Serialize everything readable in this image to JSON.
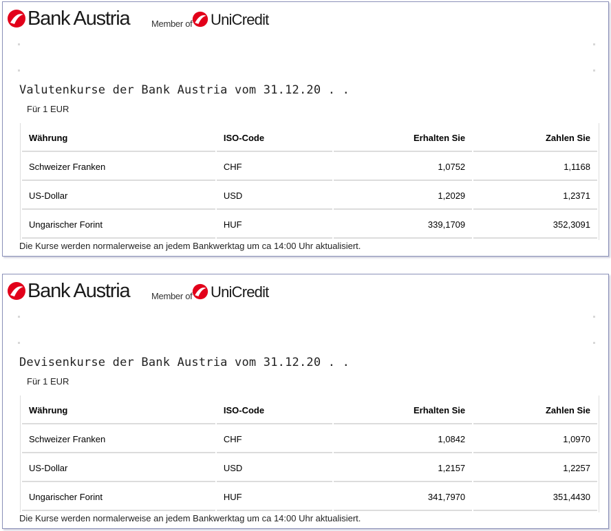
{
  "brand": {
    "logo_text": "Bank Austria",
    "member_of": "Member of",
    "partner": "UniCredit",
    "accent": "#e2001a"
  },
  "panels": [
    {
      "title": "Valutenkurse der Bank Austria vom 31.12.20 . .",
      "unit": "Für 1 EUR",
      "headers": [
        "Währung",
        "ISO-Code",
        "Erhalten Sie",
        "Zahlen Sie"
      ],
      "rows": [
        {
          "currency": "Schweizer Franken",
          "iso": "CHF",
          "receive": "1,0752",
          "pay": "1,1168"
        },
        {
          "currency": "US-Dollar",
          "iso": "USD",
          "receive": "1,2029",
          "pay": "1,2371"
        },
        {
          "currency": "Ungarischer Forint",
          "iso": "HUF",
          "receive": "339,1709",
          "pay": "352,3091"
        }
      ],
      "footer": "Die Kurse werden normalerweise an jedem Bankwerktag um ca 14:00 Uhr aktualisiert."
    },
    {
      "title": "Devisenkurse der Bank Austria vom 31.12.20 . .",
      "unit": "Für 1 EUR",
      "headers": [
        "Währung",
        "ISO-Code",
        "Erhalten Sie",
        "Zahlen Sie"
      ],
      "rows": [
        {
          "currency": "Schweizer Franken",
          "iso": "CHF",
          "receive": "1,0842",
          "pay": "1,0970"
        },
        {
          "currency": "US-Dollar",
          "iso": "USD",
          "receive": "1,2157",
          "pay": "1,2257"
        },
        {
          "currency": "Ungarischer Forint",
          "iso": "HUF",
          "receive": "341,7970",
          "pay": "351,4430"
        }
      ],
      "footer": "Die Kurse werden normalerweise an jedem Bankwerktag um ca 14:00 Uhr aktualisiert."
    }
  ]
}
